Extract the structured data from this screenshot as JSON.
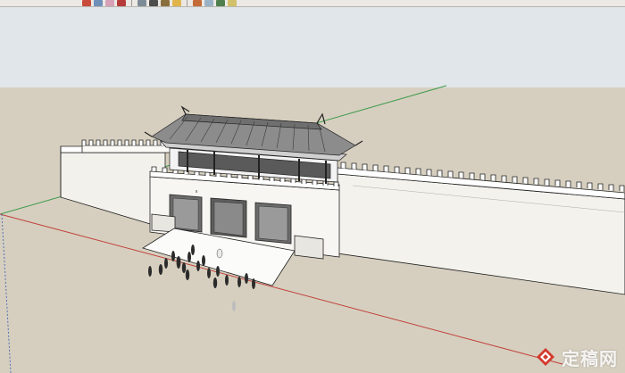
{
  "toolbar": {
    "buttons": [
      {
        "icon": "select-icon",
        "color": "#c84a3b"
      },
      {
        "icon": "component-icon",
        "color": "#6e8fb8"
      },
      {
        "icon": "eraser-icon",
        "color": "#d7a1b8"
      },
      {
        "icon": "paint-bucket-icon",
        "color": "#b53a3a"
      },
      {
        "icon": "rectangle-icon",
        "color": "#7d8b96"
      },
      {
        "icon": "line-icon",
        "color": "#4d4d4d"
      },
      {
        "icon": "arc-icon",
        "color": "#8a6f3e"
      },
      {
        "icon": "push-pull-icon",
        "color": "#e0b44a"
      },
      {
        "icon": "offset-icon",
        "color": "#c56b38"
      },
      {
        "icon": "tape-measure-icon",
        "color": "#9ab2c8"
      },
      {
        "icon": "orbit-icon",
        "color": "#4f7f4f"
      },
      {
        "icon": "zoom-icon",
        "color": "#d3c06a"
      }
    ]
  },
  "viewport": {
    "sky_color": "#e0e6e9",
    "ground_color": "#d6cfbf",
    "axis_colors": {
      "red": "#c0403a",
      "green": "#3c9a4b",
      "blue": "#5470b8"
    }
  },
  "watermark": {
    "text": "定稿网",
    "icon": "zhulong-logo-icon"
  }
}
